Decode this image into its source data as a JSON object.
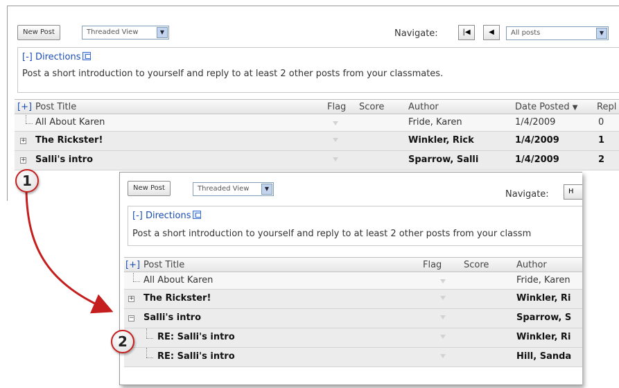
{
  "toolbar": {
    "new_post_label": "New Post",
    "view_select_value": "Threaded View",
    "navigate_label": "Navigate:",
    "first_icon": "first-page-icon",
    "prev_icon": "previous-icon",
    "filter_select_value": "All posts"
  },
  "directions": {
    "toggle_label": "[-] Directions",
    "text": "Post a short introduction to yourself and reply to at least 2 other posts from your classmates."
  },
  "grid": {
    "expand_all": "[+]",
    "columns": {
      "title": "Post Title",
      "flag": "Flag",
      "score": "Score",
      "author": "Author",
      "date": "Date Posted",
      "replies": "Repl"
    },
    "sort_indicator": "▼"
  },
  "panel1_rows": [
    {
      "title": "All About Karen",
      "author": "Fride, Karen",
      "date": "1/4/2009",
      "replies": "0",
      "bold": false
    },
    {
      "title": "The Rickster!",
      "author": "Winkler, Rick",
      "date": "1/4/2009",
      "replies": "1",
      "bold": true
    },
    {
      "title": "Salli's intro",
      "author": "Sparrow, Salli",
      "date": "1/4/2009",
      "replies": "2",
      "bold": true
    }
  ],
  "panel2": {
    "navigate_partial": "H",
    "directions_text_cropped": "Post a short introduction to yourself and reply to at least 2 other posts from your classm",
    "rows": [
      {
        "title": "All About Karen",
        "author": "Fride, Karen"
      },
      {
        "title": "The Rickster!",
        "author": "Winkler, Ri"
      },
      {
        "title": "Salli's intro",
        "author": "Sparrow, S"
      },
      {
        "title": "RE: Salli's intro",
        "author": "Winkler, Ri"
      },
      {
        "title": "RE: Salli's intro",
        "author": "Hill, Sanda"
      }
    ]
  },
  "callouts": {
    "one": "1",
    "two": "2"
  },
  "colors": {
    "link": "#1a4db3",
    "callout_border": "#c41e1e",
    "arrow": "#c41e1e"
  }
}
